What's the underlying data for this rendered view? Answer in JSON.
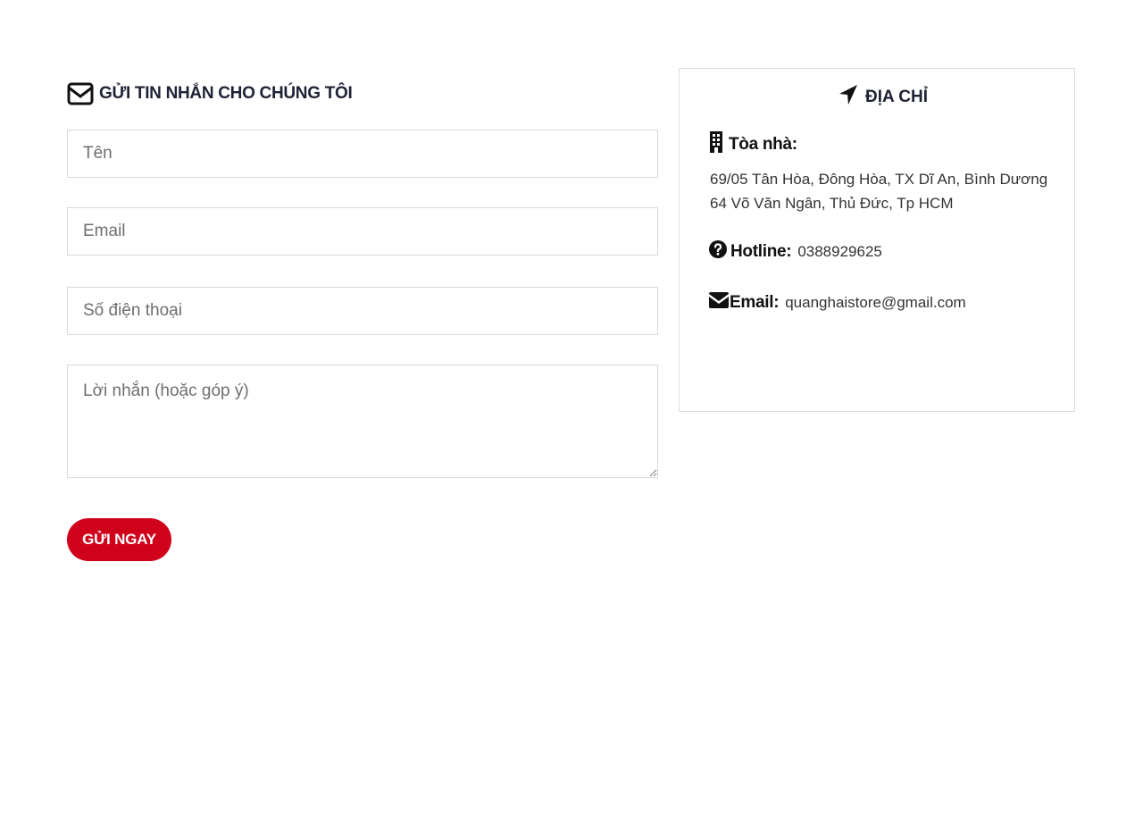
{
  "contact_form": {
    "title": "GỬI TIN NHẮN CHO CHÚNG TÔI",
    "title_icon": "envelope-outline-icon",
    "fields": {
      "name_placeholder": "Tên",
      "email_placeholder": "Email",
      "phone_placeholder": "Số điện thoại",
      "message_placeholder": "Lời nhắn (hoặc góp ý)"
    },
    "submit_label": "GỬI NGAY",
    "submit_color": "#d0021b"
  },
  "address_card": {
    "title": "ĐỊA CHỈ",
    "title_icon": "location-arrow-icon",
    "building": {
      "icon": "building-icon",
      "label": "Tòa nhà:",
      "lines": [
        "69/05 Tân Hòa, Đông Hòa, TX Dĩ An, Bình Dương",
        "64 Võ Văn Ngân, Thủ Đức, Tp HCM"
      ]
    },
    "hotline": {
      "icon": "question-circle-icon",
      "label": "Hotline:",
      "value": "0388929625"
    },
    "email": {
      "icon": "envelope-icon",
      "label": "Email:",
      "value": "quanghaistore@gmail.com"
    }
  }
}
